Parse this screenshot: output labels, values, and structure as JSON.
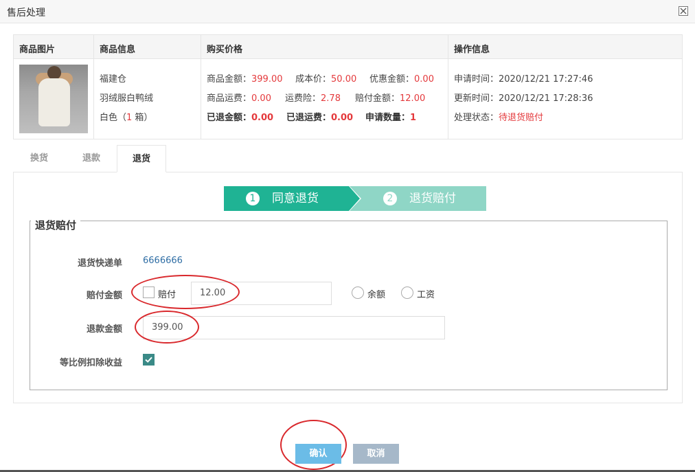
{
  "window": {
    "title": "售后处理"
  },
  "table": {
    "headers": [
      "商品图片",
      "商品信息",
      "购买价格",
      "操作信息"
    ],
    "product": {
      "warehouse": "福建仓",
      "name": "羽绒服白鸭绒",
      "spec_prefix": "白色（",
      "spec_qty": "1",
      "spec_suffix": " 箱）"
    },
    "price": {
      "goods_amount_label": "商品金额：",
      "goods_amount": "399.00",
      "cost_label": "成本价：",
      "cost": "50.00",
      "discount_label": "优惠金额：",
      "discount": "0.00",
      "shipping_label": "商品运费：",
      "shipping": "0.00",
      "insurance_label": "运费险：",
      "insurance": "2.78",
      "compensation_label": "赔付金额：",
      "compensation": "12.00",
      "refunded_label": "已退金额：",
      "refunded": "0.00",
      "refunded_shipping_label": "已退运费：",
      "refunded_shipping": "0.00",
      "apply_qty_label": "申请数量：",
      "apply_qty": "1"
    },
    "operation": {
      "apply_time_label": "申请时间：",
      "apply_time": "2020/12/21 17:27:46",
      "update_time_label": "更新时间：",
      "update_time": "2020/12/21 17:28:36",
      "status_label": "处理状态：",
      "status": "待退货赔付"
    }
  },
  "tabs": [
    {
      "label": "换货"
    },
    {
      "label": "退款"
    },
    {
      "label": "退货"
    }
  ],
  "active_tab": "退货",
  "steps": [
    {
      "num": "1",
      "label": "同意退货"
    },
    {
      "num": "2",
      "label": "退货赔付"
    }
  ],
  "form": {
    "legend": "退货赔付",
    "tracking_label": "退货快递单",
    "tracking_value": "6666666",
    "compensation_label": "赔付金额",
    "compensation_checkbox_label": "赔付",
    "compensation_value": "12.00",
    "radio_balance": "余额",
    "radio_salary": "工资",
    "refund_label": "退款金额",
    "refund_value": "399.00",
    "deduct_label": "等比例扣除收益"
  },
  "buttons": {
    "confirm": "确认",
    "cancel": "取消"
  },
  "colors": {
    "accent_red": "#e4393c",
    "step_active": "#1fb394",
    "step_inactive": "#8fd6c6",
    "confirm": "#6bbce7",
    "cancel": "#a6b8c9",
    "annotation": "#d9282c"
  }
}
